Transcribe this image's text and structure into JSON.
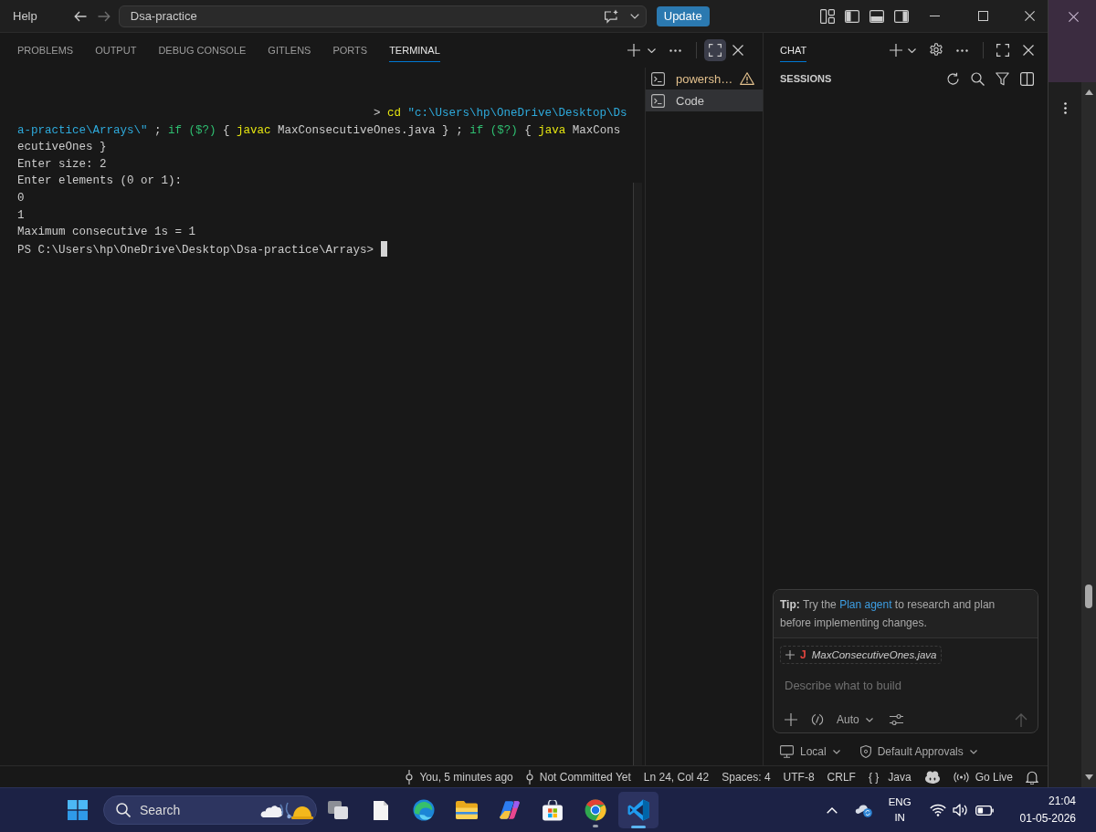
{
  "title_bar": {
    "menu": "Help",
    "command_center": "Dsa-practice",
    "update_button": "Update"
  },
  "panel": {
    "tabs": [
      {
        "label": "PROBLEMS",
        "selected": false
      },
      {
        "label": "OUTPUT",
        "selected": false
      },
      {
        "label": "DEBUG CONSOLE",
        "selected": false
      },
      {
        "label": "GITLENS",
        "selected": false
      },
      {
        "label": "PORTS",
        "selected": false
      },
      {
        "label": "TERMINAL",
        "selected": true
      }
    ],
    "maximized": true
  },
  "terminal": {
    "lines": [
      {
        "kind": "echo",
        "segments": [
          {
            "kind": "plain",
            "text": "> "
          },
          {
            "kind": "command",
            "text": "cd"
          },
          {
            "kind": "string",
            "text": " \"c:\\Users\\hp\\OneDrive\\Desktop\\Ds"
          }
        ]
      },
      {
        "kind": "output",
        "segments": [
          {
            "kind": "string",
            "text": "a-practice\\Arrays\\\""
          },
          {
            "kind": "plain",
            "text": " ; "
          },
          {
            "kind": "keyword",
            "text": "if ($?)"
          },
          {
            "kind": "plain",
            "text": " { "
          },
          {
            "kind": "command",
            "text": "javac"
          },
          {
            "kind": "plain",
            "text": " MaxConsecutiveOnes.java } ; "
          },
          {
            "kind": "keyword",
            "text": "if ($?)"
          },
          {
            "kind": "plain",
            "text": " { "
          },
          {
            "kind": "command",
            "text": "java"
          },
          {
            "kind": "plain",
            "text": " MaxCons"
          }
        ]
      },
      {
        "kind": "output",
        "segments": [
          {
            "kind": "plain",
            "text": "ecutiveOnes }"
          }
        ]
      },
      {
        "kind": "output",
        "segments": [
          {
            "kind": "plain",
            "text": "Enter size: 2"
          }
        ]
      },
      {
        "kind": "output",
        "segments": [
          {
            "kind": "plain",
            "text": "Enter elements (0 or 1):"
          }
        ]
      },
      {
        "kind": "output",
        "segments": [
          {
            "kind": "plain",
            "text": "0"
          }
        ]
      },
      {
        "kind": "output",
        "segments": [
          {
            "kind": "plain",
            "text": "1"
          }
        ]
      },
      {
        "kind": "output",
        "segments": [
          {
            "kind": "plain",
            "text": "Maximum consecutive 1s = 1"
          }
        ]
      },
      {
        "kind": "output",
        "segments": [
          {
            "kind": "plain",
            "text": "PS C:\\Users\\hp\\OneDrive\\Desktop\\Dsa-practice\\Arrays>"
          }
        ]
      }
    ],
    "cursor": true
  },
  "terminal_list": [
    {
      "label": "powersh…",
      "warning": true,
      "selected": false
    },
    {
      "label": "Code",
      "warning": false,
      "selected": true
    }
  ],
  "chat": {
    "tabs": [
      {
        "label": "CHAT",
        "selected": true
      }
    ],
    "sessions_heading": "SESSIONS",
    "tip": {
      "text": "**Tip:** Try the",
      "link": "Plan agent",
      "rest": "to research and plan before implementing changes."
    },
    "attachment": {
      "file_icon": "J",
      "name": "MaxConsecutiveOnes.java"
    },
    "input": {
      "placeholder": "Describe what to build"
    },
    "mode": "Auto",
    "send_button": {
      "disabled": true
    },
    "target": "Local",
    "approvals": "Default Approvals"
  },
  "status_bar": {
    "items": [
      {
        "kind": "commit",
        "label": "You, 5 minutes ago"
      },
      {
        "kind": "commit",
        "label": "Not Committed Yet"
      },
      {
        "kind": "text",
        "label": "Ln 24, Col 42"
      },
      {
        "kind": "text",
        "label": "Spaces: 4"
      },
      {
        "kind": "text",
        "label": "UTF-8"
      },
      {
        "kind": "text",
        "label": "CRLF"
      },
      {
        "kind": "language",
        "glyph": "{ }",
        "label": "Java"
      },
      {
        "kind": "assistant"
      },
      {
        "kind": "live",
        "label": "Go Live"
      },
      {
        "kind": "bell"
      }
    ]
  },
  "taskbar": {
    "search": {
      "placeholder": "Search"
    },
    "apps": [
      {
        "kind": "task-view",
        "running": false,
        "active": false
      },
      {
        "kind": "document",
        "running": false,
        "active": false
      },
      {
        "kind": "swirl",
        "running": false,
        "active": false
      },
      {
        "kind": "folder",
        "running": false,
        "active": false
      },
      {
        "kind": "petal",
        "running": false,
        "active": false
      },
      {
        "kind": "store",
        "running": false,
        "active": false
      },
      {
        "kind": "tricolor",
        "running": true,
        "active": false
      },
      {
        "kind": "ribbon",
        "running": true,
        "active": true
      }
    ],
    "language": [
      "ENG",
      "IN"
    ],
    "time": "21:04",
    "date": "01-05-2026"
  }
}
